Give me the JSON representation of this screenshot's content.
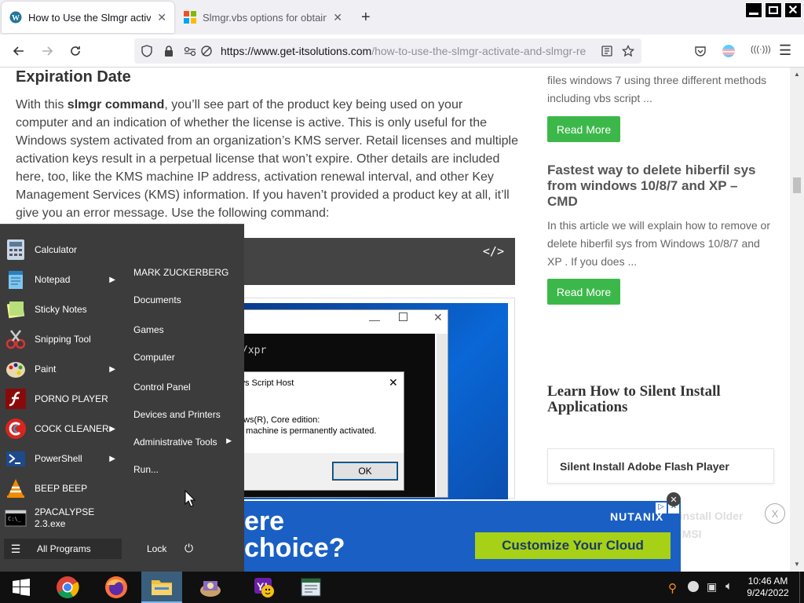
{
  "tabs": [
    {
      "title": "How to Use the Slmgr activate a",
      "icon": "wordpress-icon",
      "active": true
    },
    {
      "title": "Slmgr.vbs options for obtaining",
      "icon": "microsoft-icon",
      "active": false
    }
  ],
  "nav": {
    "url_domain": "https://www.get-itsolutions.com",
    "url_rest": "/how-to-use-the-slmgr-activate-and-slmgr-re"
  },
  "article": {
    "heading": "Expiration Date",
    "para_lead": "With this ",
    "para_bold": "slmgr command",
    "para_rest": ", you’ll see part of the product key being used on your computer and an indication of whether the license is active. This is only useful for the Windows system activated from an organization’s KMS server. Retail licenses and multiple activation keys result in a perpetual license that won’t expire. Other details are included here, too, like the KMS machine  IP address, activation renewal interval, and other Key Management Services (KMS) information. If you haven’t provided a product key at all, it’ll give you an error message. Use the following command:",
    "code_icon": "</>"
  },
  "screenshot": {
    "cmd_text": "/xpr",
    "dialog_title": "ws Script Host",
    "dialog_line1": "ows(R), Core edition:",
    "dialog_line2": "e machine is permanently activated.",
    "ok_label": "OK"
  },
  "sidebar": {
    "snippet1": "files windows 7 using three different methods including vbs script ...",
    "read_more_1": "Read More",
    "post2_title": "Fastest way to delete hiberfil sys from windows 10/8/7 and XP – CMD",
    "post2_snippet": "In this article we will explain how to remove or delete hiberfil sys from Windows 10/8/7 and XP . If you does ...",
    "read_more_2": "Read More",
    "section_title": "Learn How to Silent Install Applications",
    "link1": "Silent Install Adobe Flash Player",
    "link2_partial": "hinstall Older",
    "link3_partial": "e MSI",
    "close_x": "X"
  },
  "start_menu": {
    "programs": [
      {
        "label": "Calculator",
        "icon": "calculator-icon",
        "arrow": false
      },
      {
        "label": "Notepad",
        "icon": "notepad-icon",
        "arrow": true
      },
      {
        "label": "Sticky Notes",
        "icon": "sticky-notes-icon",
        "arrow": false
      },
      {
        "label": "Snipping Tool",
        "icon": "snipping-tool-icon",
        "arrow": false
      },
      {
        "label": "Paint",
        "icon": "paint-icon",
        "arrow": true
      },
      {
        "label": "PORNO PLAYER",
        "icon": "flash-player-icon",
        "arrow": false
      },
      {
        "label": "COCK CLEANER",
        "icon": "ccleaner-icon",
        "arrow": true
      },
      {
        "label": "PowerShell",
        "icon": "powershell-icon",
        "arrow": true
      },
      {
        "label": "BEEP BEEP",
        "icon": "vlc-icon",
        "arrow": false
      },
      {
        "label": "2PACALYPSE 2.3.exe",
        "icon": "cmd-icon",
        "arrow": false
      }
    ],
    "all_programs": "All Programs",
    "right_items": [
      "MARK ZUCKERBERG",
      "Documents",
      "Games",
      "Computer",
      "Control Panel",
      "Devices and Printers",
      "Administrative Tools",
      "Run..."
    ],
    "lock": "Lock"
  },
  "ad": {
    "text_line1": "ere",
    "text_line2": "choice?",
    "brand": "NUTANIX",
    "cta": "Customize Your Cloud"
  },
  "taskbar": {
    "time": "10:46 AM",
    "date": "9/24/2022"
  },
  "colors": {
    "green_button": "#3cb84a",
    "ad_blue": "#1a5fc4",
    "ad_cta": "#a6d116",
    "start_bg": "#3c3c3c"
  }
}
